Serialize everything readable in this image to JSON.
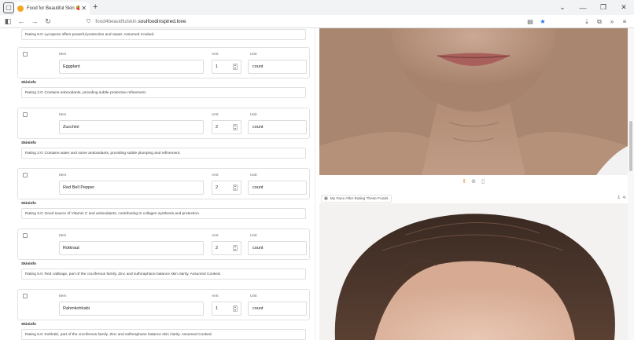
{
  "browser": {
    "tab_title": "Food for Beautiful Skin 🍓🥑🍋",
    "url_subdomain": "food4beautifulskin.",
    "url_domain": "soulfoodinspired.love"
  },
  "labels": {
    "item": "Item",
    "amt": "Amt",
    "unit": "Unit",
    "skininfo": "Skininfo"
  },
  "top_rating": "Rating 8.0: Lycopene offers powerful protection and repair. Assumed Cooked.",
  "items": [
    {
      "name": "Eggplant",
      "amt": "1",
      "unit": "count",
      "skininfo": "Rating 2.0: Contains antioxidants, providing subtle protective refinement."
    },
    {
      "name": "Zucchini",
      "amt": "2",
      "unit": "count",
      "skininfo": "Rating 2.0: Contains water and some antioxidants, providing subtle plumping and refinement."
    },
    {
      "name": "Red Bell Pepper",
      "amt": "2",
      "unit": "count",
      "skininfo": "Rating 3.0: Good source of Vitamin C and antioxidants, contributing to collagen synthesis and protection."
    },
    {
      "name": "Rotkraut",
      "amt": "2",
      "unit": "count",
      "skininfo": "Rating 5.0: Red cabbage, part of the cruciferous family. Zinc and sulforaphane balance skin clarity. Assumed Cooked."
    },
    {
      "name": "Rahmkohlrabi",
      "amt": "1",
      "unit": "count",
      "skininfo": "Rating 5.0: Kohlrabi, part of the cruciferous family. Zinc and sulforaphane balance skin clarity. Assumed Cooked."
    }
  ],
  "photo2_label": "My Face After Eating These Foods",
  "icons": {
    "share": "share-icon",
    "download": "download-icon",
    "image": "image-icon"
  }
}
